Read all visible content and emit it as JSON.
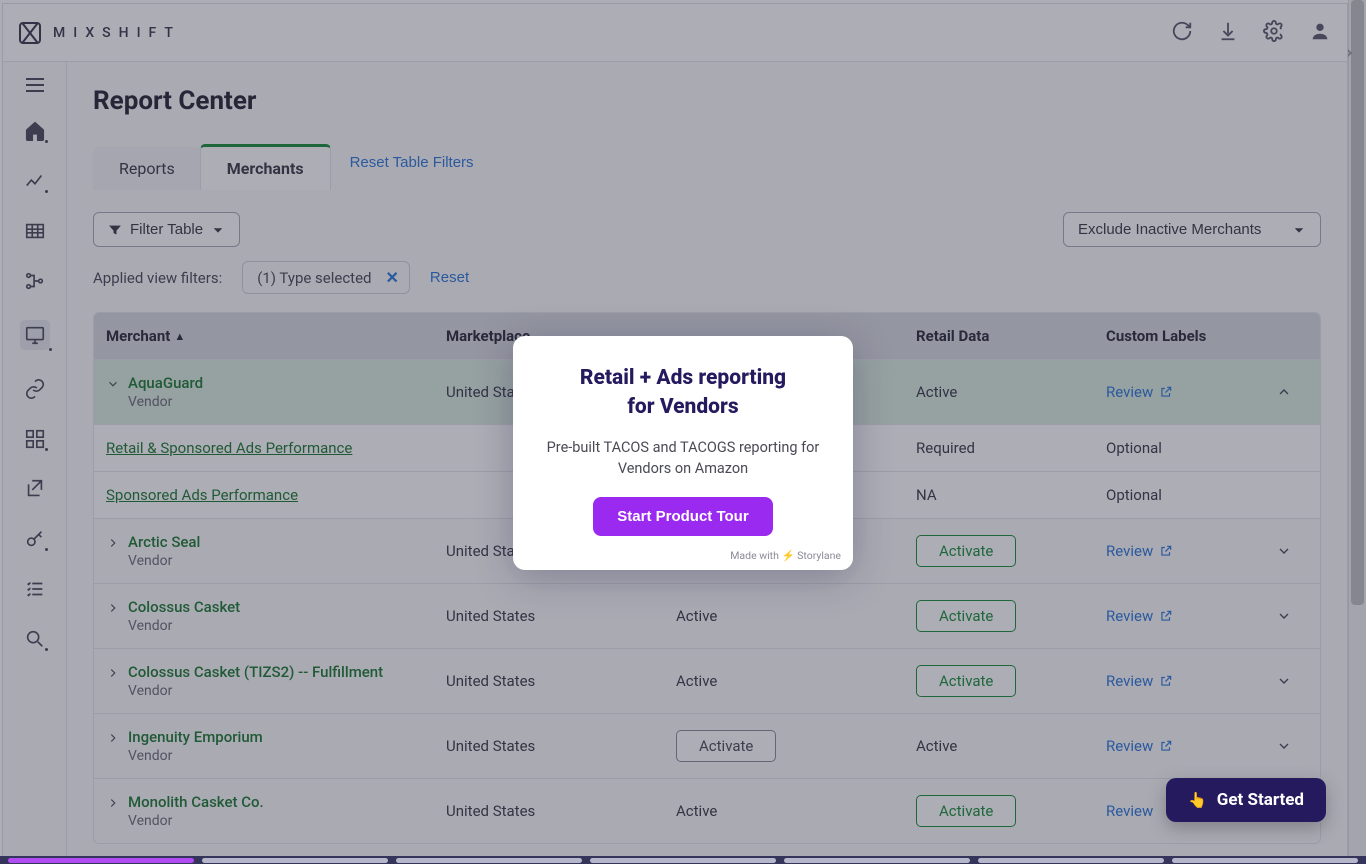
{
  "brand_word": "MIXSHIFT",
  "page_title": "Report Center",
  "tabs": {
    "reports": "Reports",
    "merchants": "Merchants"
  },
  "reset_filters_link": "Reset Table Filters",
  "filter_btn": "Filter Table",
  "exclude_select": "Exclude Inactive Merchants",
  "applied_label": "Applied view filters:",
  "chip_text": "(1) Type selected",
  "reset_link": "Reset",
  "columns": {
    "merchant": "Merchant",
    "marketplace": "Marketplace",
    "ads": "",
    "retail": "Retail Data",
    "labels": "Custom Labels"
  },
  "review_label": "Review",
  "activate_label": "Activate",
  "marketplace_us": "United States",
  "status_active": "Active",
  "status_required": "Required",
  "status_na": "NA",
  "status_optional": "Optional",
  "vendor_sub": "Vendor",
  "subrows": {
    "retail_ads": "Retail & Sponsored Ads Performance",
    "sponsored": "Sponsored Ads Performance"
  },
  "merchants": [
    {
      "name": "AquaGuard",
      "expanded": true,
      "ads_state": "text",
      "retail_state": "text",
      "review": true
    },
    {
      "name": "Arctic Seal"
    },
    {
      "name": "Colossus Casket"
    },
    {
      "name": "Colossus Casket (TIZS2) -- Fulfillment"
    },
    {
      "name": "Ingenuity Emporium",
      "ads_btn": true,
      "retail_text": true
    },
    {
      "name": "Monolith Casket Co."
    }
  ],
  "modal": {
    "title_l1": "Retail + Ads reporting",
    "title_l2": "for Vendors",
    "body": "Pre-built TACOS and TACOGS reporting for Vendors on Amazon",
    "cta": "Start Product Tour",
    "made": "Made with ⚡ Storylane"
  },
  "get_started": "Get Started"
}
